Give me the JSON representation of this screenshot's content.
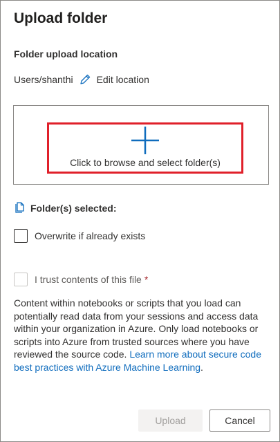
{
  "dialog": {
    "title": "Upload folder",
    "location_heading": "Folder upload location",
    "location_path": "Users/shanthi",
    "edit_location_label": "Edit location",
    "dropzone_label": "Click to browse and select folder(s)",
    "selected_label": "Folder(s) selected:",
    "overwrite_label": "Overwrite if already exists",
    "trust_label": "I trust contents of this file",
    "required_marker": "*",
    "disclaimer_text": "Content within notebooks or scripts that you load can potentially read data from your sessions and access data within your organization in Azure. Only load notebooks or scripts into Azure from trusted sources where you have reviewed the source code.",
    "learn_more_link": "Learn more about secure code best practices with Azure Machine Learning",
    "disclaimer_end": ".",
    "upload_button": "Upload",
    "cancel_button": "Cancel"
  },
  "state": {
    "overwrite_checked": false,
    "trust_checked": false,
    "trust_disabled": true,
    "upload_disabled": true
  },
  "icons": {
    "edit": "pencil-icon",
    "dropzone": "plus-icon",
    "selected": "document-copy-icon"
  },
  "colors": {
    "accent": "#0f6cbd",
    "highlight_border": "#e0202a",
    "required": "#a4262c"
  }
}
